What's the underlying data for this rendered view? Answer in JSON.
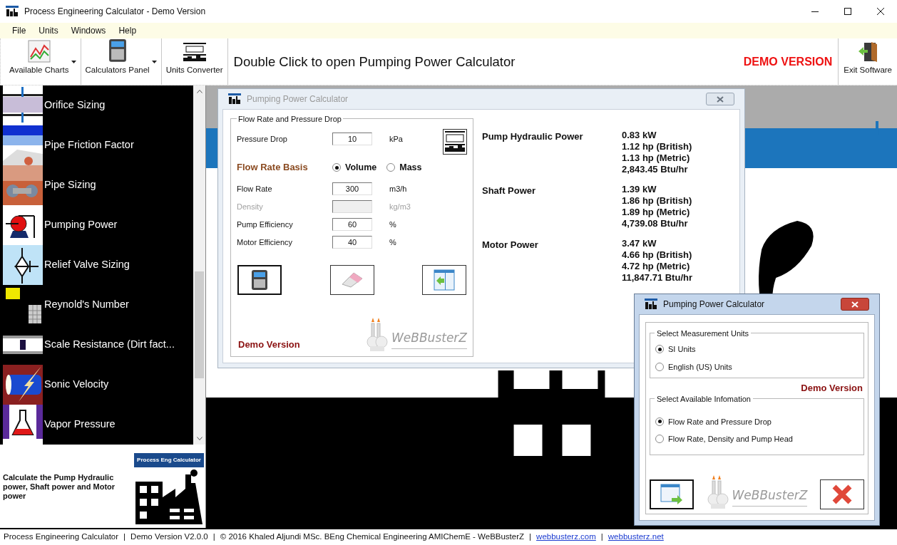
{
  "window": {
    "title": "Process Engineering Calculator - Demo Version"
  },
  "menu": [
    "File",
    "Units",
    "Windows",
    "Help"
  ],
  "toolbar": {
    "buttons": [
      {
        "label": "Available Charts",
        "dropdown": true
      },
      {
        "label": "Calculators Panel",
        "dropdown": true
      },
      {
        "label": "Units Converter",
        "dropdown": false
      }
    ],
    "message": "Double Click to open Pumping Power Calculator",
    "demo_badge": "DEMO VERSION",
    "exit_label": "Exit Software"
  },
  "sidebar": {
    "items": [
      {
        "label": "Orifice Sizing"
      },
      {
        "label": "Pipe Friction Factor"
      },
      {
        "label": "Pipe Sizing"
      },
      {
        "label": "Pumping Power"
      },
      {
        "label": "Relief Valve Sizing"
      },
      {
        "label": "Reynold's Number"
      },
      {
        "label": "Scale Resistance (Dirt fact..."
      },
      {
        "label": "Sonic Velocity"
      },
      {
        "label": "Vapor Pressure"
      }
    ],
    "description": "Calculate the Pump Hydraulic power, Shaft power and Motor power",
    "logo_caption": "Process Eng Calculator"
  },
  "calculator_window": {
    "title": "Pumping Power Calculator",
    "active": false,
    "group_title": "Flow Rate and Pressure Drop",
    "pressure_drop": {
      "label": "Pressure Drop",
      "value": "10",
      "unit": "kPa",
      "disabled": false
    },
    "flow_rate_basis": {
      "label": "Flow Rate Basis",
      "options": [
        {
          "label": "Volume",
          "selected": true
        },
        {
          "label": "Mass",
          "selected": false
        }
      ]
    },
    "fields": [
      {
        "label": "Flow Rate",
        "value": "300",
        "unit": "m3/h",
        "disabled": false
      },
      {
        "label": "Density",
        "unit": "kg/m3",
        "disabled": true
      },
      {
        "label": "Pump Efficiency",
        "value": "60",
        "unit": "%",
        "disabled": false
      },
      {
        "label": "Motor Efficiency",
        "value": "40",
        "unit": "%",
        "disabled": false
      }
    ],
    "demo_label": "Demo Version",
    "logo_text": "WeBBusterZ",
    "results": [
      {
        "title": "Pump Hydraulic Power",
        "values": [
          "0.83 kW",
          "1.12 hp (British)",
          "1.13 hp (Metric)",
          "2,843.45 Btu/hr"
        ]
      },
      {
        "title": "Shaft Power",
        "values": [
          "1.39 kW",
          "1.86 hp (British)",
          "1.89 hp (Metric)",
          "4,739.08 Btu/hr"
        ]
      },
      {
        "title": "Motor Power",
        "values": [
          "3.47 kW",
          "4.66 hp (British)",
          "4.72 hp (Metric)",
          "11,847.71 Btu/hr"
        ]
      }
    ]
  },
  "units_window": {
    "title": "Pumping Power Calculator",
    "active": true,
    "groups": [
      {
        "title": "Select Measurement Units",
        "options": [
          {
            "label": "SI Units",
            "selected": true
          },
          {
            "label": "English (US) Units",
            "selected": false
          }
        ]
      },
      {
        "title": "Select Available Infomation",
        "options": [
          {
            "label": "Flow Rate and Pressure Drop",
            "selected": true
          },
          {
            "label": "Flow Rate, Density and Pump Head",
            "selected": false
          }
        ]
      }
    ],
    "demo_label": "Demo Version",
    "logo_text": "WeBBusterZ"
  },
  "status_bar": [
    {
      "kind": "text",
      "text": "Process Engineering Calculator"
    },
    {
      "kind": "separator",
      "text": "|"
    },
    {
      "kind": "text",
      "text": "Demo Version V2.0.0"
    },
    {
      "kind": "separator",
      "text": "|"
    },
    {
      "kind": "text",
      "text": "© 2016 Khaled Aljundi MSc. BEng Chemical Engineering AMIChemE - WeBBusterZ"
    },
    {
      "kind": "separator",
      "text": "|"
    },
    {
      "kind": "link",
      "text": "webbusterz.com"
    },
    {
      "kind": "separator",
      "text": "|"
    },
    {
      "kind": "link",
      "text": "webbusterz.net"
    }
  ]
}
